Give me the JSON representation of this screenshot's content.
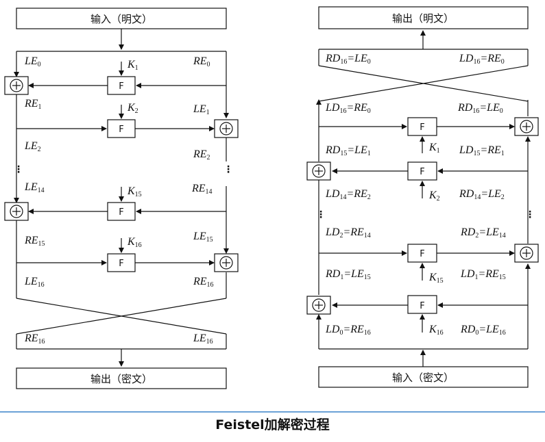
{
  "caption": "Feistel加解密过程",
  "encryption": {
    "input_label": "输入（明文）",
    "output_label": "输出（密文）",
    "top_left": {
      "b": "LE",
      "s": "0"
    },
    "top_right": {
      "b": "RE",
      "s": "0"
    },
    "k1": {
      "b": "K",
      "s": "1"
    },
    "k2": {
      "b": "K",
      "s": "2"
    },
    "k15": {
      "b": "K",
      "s": "15"
    },
    "k16": {
      "b": "K",
      "s": "16"
    },
    "re1": {
      "b": "RE",
      "s": "1"
    },
    "le1": {
      "b": "LE",
      "s": "1"
    },
    "le2": {
      "b": "LE",
      "s": "2"
    },
    "re2": {
      "b": "RE",
      "s": "2"
    },
    "le14": {
      "b": "LE",
      "s": "14"
    },
    "re14": {
      "b": "RE",
      "s": "14"
    },
    "re15": {
      "b": "RE",
      "s": "15"
    },
    "le15": {
      "b": "LE",
      "s": "15"
    },
    "le16": {
      "b": "LE",
      "s": "16"
    },
    "re16": {
      "b": "RE",
      "s": "16"
    },
    "out_left": {
      "b": "RE",
      "s": "16"
    },
    "out_right": {
      "b": "LE",
      "s": "16"
    }
  },
  "decryption": {
    "output_label": "输出（明文）",
    "input_label": "输入（密文）",
    "top_left": {
      "a": "RD",
      "as": "16",
      "b": "LE",
      "bs": "0"
    },
    "top_right": {
      "a": "LD",
      "as": "16",
      "b": "RE",
      "bs": "0"
    },
    "ld16": {
      "a": "LD",
      "as": "16",
      "b": "RE",
      "bs": "0"
    },
    "rd16": {
      "a": "RD",
      "as": "16",
      "b": "LE",
      "bs": "0"
    },
    "k1": {
      "b": "K",
      "s": "1"
    },
    "rd15": {
      "a": "RD",
      "as": "15",
      "b": "LE",
      "bs": "1"
    },
    "ld15": {
      "a": "LD",
      "as": "15",
      "b": "RE",
      "bs": "1"
    },
    "k2": {
      "b": "K",
      "s": "2"
    },
    "ld14": {
      "a": "LD",
      "as": "14",
      "b": "RE",
      "bs": "2"
    },
    "rd14": {
      "a": "RD",
      "as": "14",
      "b": "LE",
      "bs": "2"
    },
    "ld2": {
      "a": "LD",
      "as": "2",
      "b": "RE",
      "bs": "14"
    },
    "rd2": {
      "a": "RD",
      "as": "2",
      "b": "LE",
      "bs": "14"
    },
    "k15": {
      "b": "K",
      "s": "15"
    },
    "rd1": {
      "a": "RD",
      "as": "1",
      "b": "LE",
      "bs": "15"
    },
    "ld1": {
      "a": "LD",
      "as": "1",
      "b": "RE",
      "bs": "15"
    },
    "k16": {
      "b": "K",
      "s": "16"
    },
    "ld0": {
      "a": "LD",
      "as": "0",
      "b": "RE",
      "bs": "16"
    },
    "rd0": {
      "a": "RD",
      "as": "0",
      "b": "LE",
      "bs": "16"
    }
  },
  "symbols": {
    "function_box": "F",
    "equals": "=",
    "ellipsis": "⋮"
  }
}
